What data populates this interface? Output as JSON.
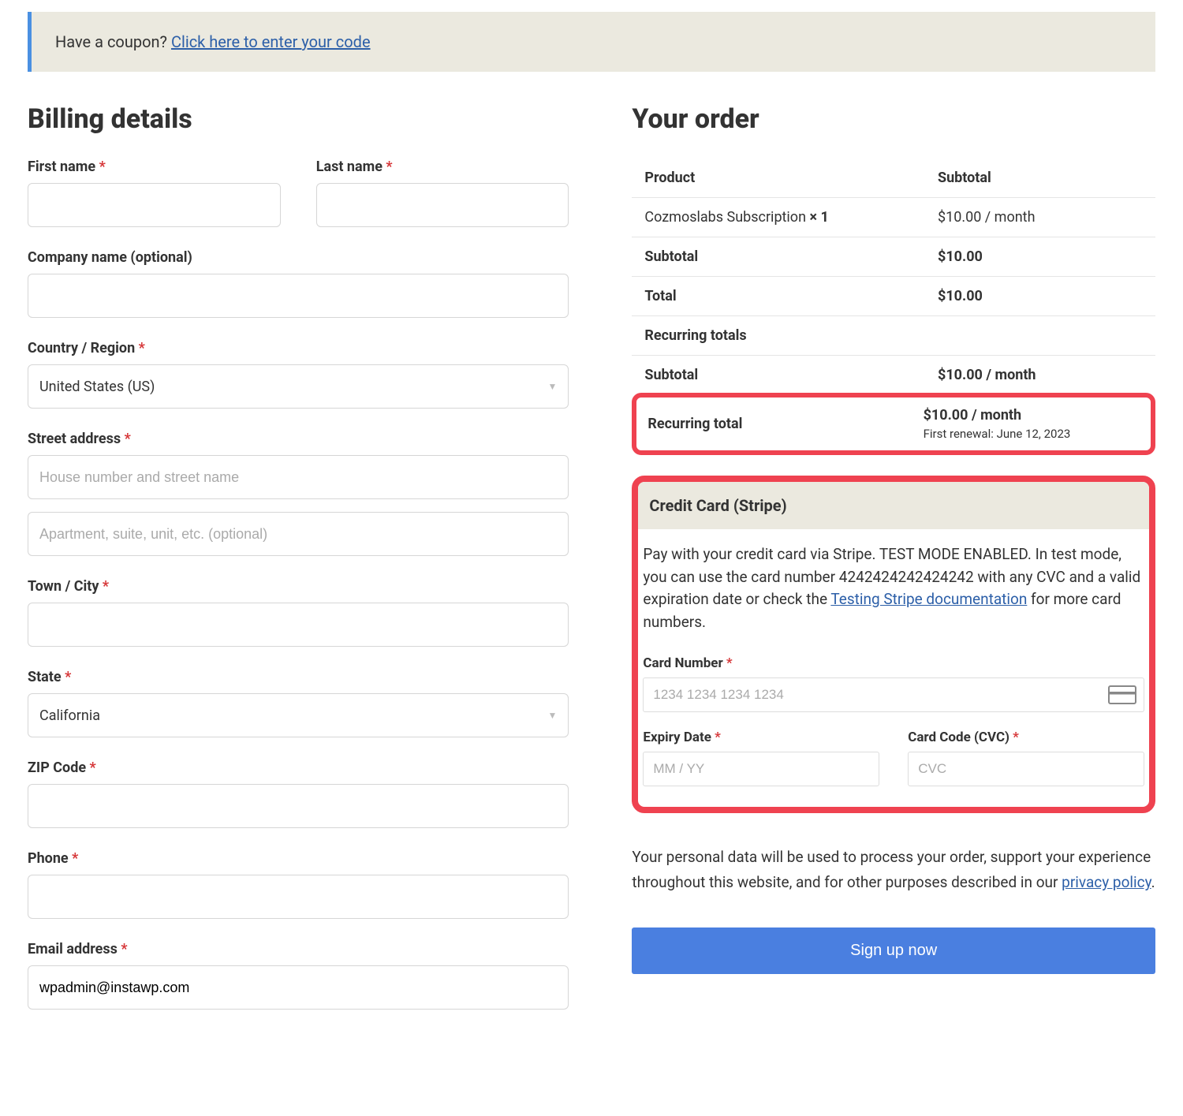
{
  "coupon": {
    "prompt": "Have a coupon? ",
    "link_text": "Click here to enter your code"
  },
  "billing": {
    "title": "Billing details",
    "first_name_label": "First name ",
    "last_name_label": "Last name ",
    "company_label": "Company name (optional)",
    "country_label": "Country / Region ",
    "country_value": "United States (US)",
    "street_label": "Street address ",
    "street1_placeholder": "House number and street name",
    "street2_placeholder": "Apartment, suite, unit, etc. (optional)",
    "city_label": "Town / City ",
    "state_label": "State ",
    "state_value": "California",
    "zip_label": "ZIP Code ",
    "phone_label": "Phone ",
    "email_label": "Email address ",
    "email_value": "wpadmin@instawp.com"
  },
  "order": {
    "title": "Your order",
    "th_product": "Product",
    "th_subtotal": "Subtotal",
    "product_name": "Cozmoslabs Subscription  ",
    "product_qty": "× 1",
    "product_price": "$10.00 / month",
    "subtotal_label": "Subtotal",
    "subtotal_value": "$10.00",
    "total_label": "Total",
    "total_value": "$10.00",
    "recurring_header": "Recurring totals",
    "recurring_subtotal_label": "Subtotal",
    "recurring_subtotal_value": "$10.00 / month",
    "recurring_total_label": "Recurring total",
    "recurring_total_value": "$10.00 / month",
    "first_renewal": "First renewal: June 12, 2023"
  },
  "payment": {
    "method_title": "Credit Card (Stripe)",
    "description_pre": "Pay with your credit card via Stripe. TEST MODE ENABLED. In test mode, you can use the card number 4242424242424242 with any CVC and a valid expiration date or check the ",
    "description_link": "Testing Stripe documentation",
    "description_post": " for more card numbers.",
    "card_number_label": "Card Number ",
    "card_number_placeholder": "1234 1234 1234 1234",
    "expiry_label": "Expiry Date ",
    "expiry_placeholder": "MM / YY",
    "cvc_label": "Card Code (CVC) ",
    "cvc_placeholder": "CVC"
  },
  "privacy": {
    "text_pre": "Your personal data will be used to process your order, support your experience throughout this website, and for other purposes described in our ",
    "link": "privacy policy",
    "text_post": "."
  },
  "signup_button": "Sign up now",
  "star": "*"
}
